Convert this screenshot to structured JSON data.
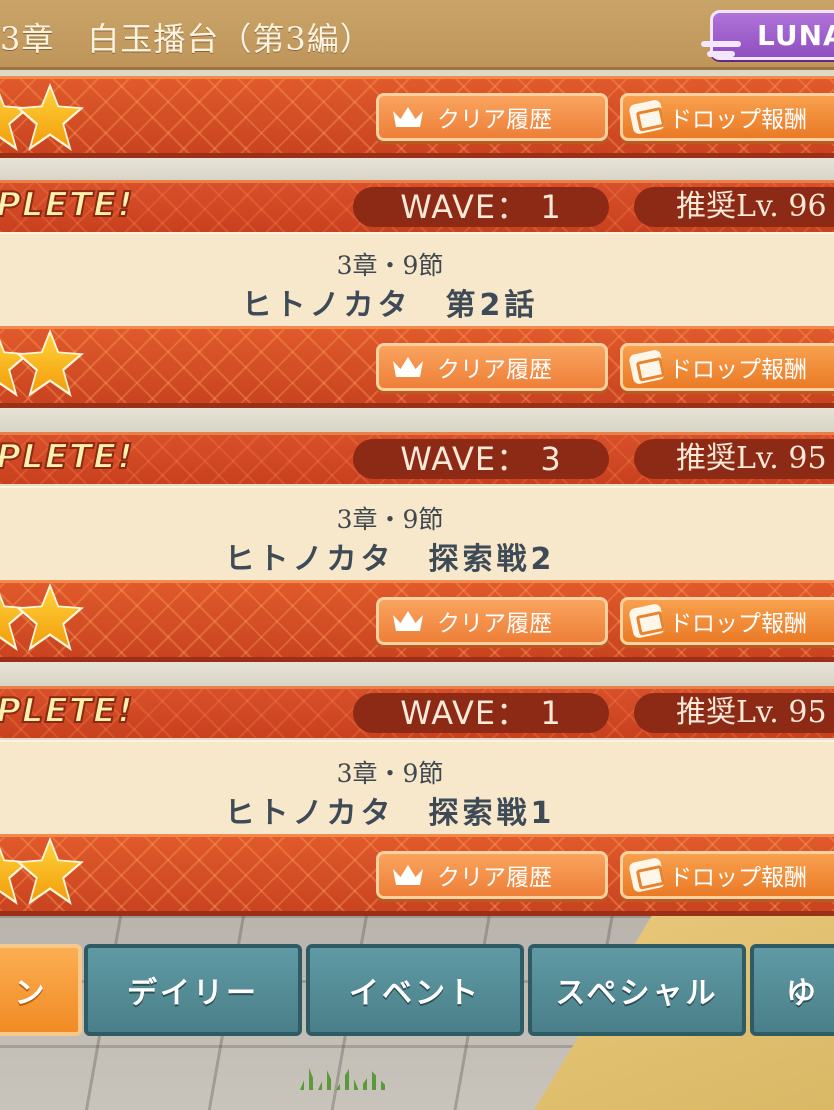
{
  "header": {
    "title": "3章　白玉播台（第3編）",
    "difficulty": "LUNA"
  },
  "quests": [
    {
      "stars": 3,
      "complete_text": "",
      "wave": "",
      "recommended_level": "",
      "section": "",
      "name": "",
      "clear_history_label": "クリア履歴",
      "drop_reward_label": "ドロップ報酬",
      "top_only": true
    },
    {
      "complete_text": "PLETE!",
      "wave": "WAVE： 1",
      "recommended_level": "推奨Lv. 96",
      "section": "3章・9節",
      "name": "ヒトノカタ　第2話",
      "stars": 3,
      "clear_history_label": "クリア履歴",
      "drop_reward_label": "ドロップ報酬"
    },
    {
      "complete_text": "PLETE!",
      "wave": "WAVE： 3",
      "recommended_level": "推奨Lv. 95",
      "section": "3章・9節",
      "name": "ヒトノカタ　探索戦2",
      "stars": 3,
      "clear_history_label": "クリア履歴",
      "drop_reward_label": "ドロップ報酬"
    },
    {
      "complete_text": "PLETE!",
      "wave": "WAVE： 1",
      "recommended_level": "推奨Lv. 95",
      "section": "3章・9節",
      "name": "ヒトノカタ　探索戦1",
      "stars": 3,
      "clear_history_label": "クリア履歴",
      "drop_reward_label": "ドロップ報酬"
    }
  ],
  "tabs": [
    {
      "label": "ン",
      "active": true
    },
    {
      "label": "デイリー",
      "active": false
    },
    {
      "label": "イベント",
      "active": false
    },
    {
      "label": "スペシャル",
      "active": false
    },
    {
      "label": "ゆ",
      "active": false
    }
  ],
  "colors": {
    "header": "#c9a468",
    "quest_bar": "#e05a2c",
    "info_panel": "#f7e7cb",
    "tab": "#5f9aa4",
    "tab_active": "#f18b24",
    "difficulty_badge": "#a465d0"
  }
}
